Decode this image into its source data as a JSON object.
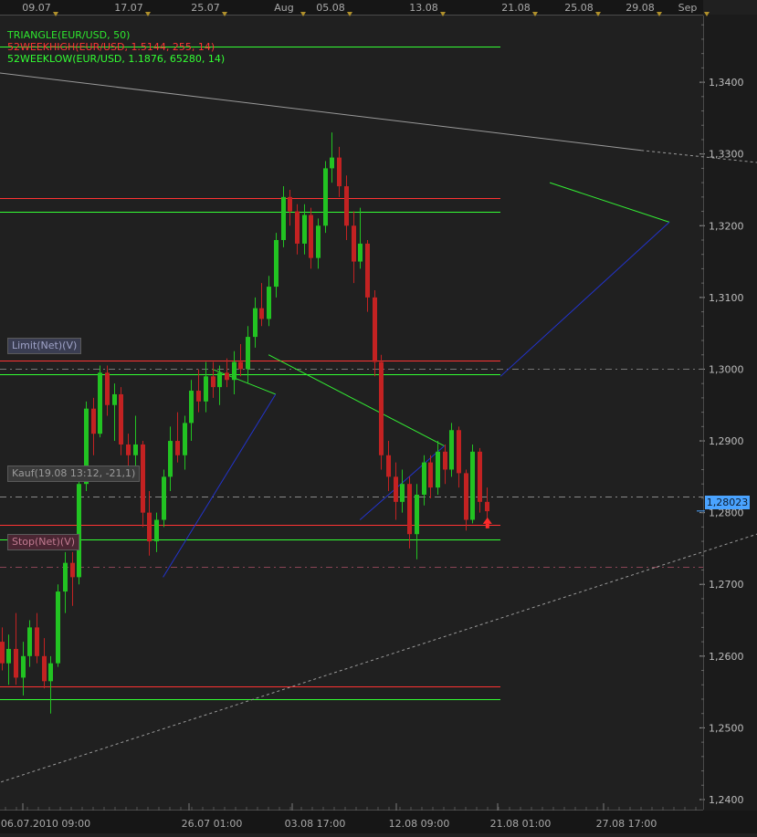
{
  "chart_data": {
    "type": "candlestick",
    "instrument": "EUR/USD",
    "top_dates": [
      "09.07",
      "17.07",
      "25.07",
      "Aug",
      "05.08",
      "13.08",
      "21.08",
      "25.08",
      "29.08",
      "Sep"
    ],
    "bottom_dates": [
      "06.07.2010 09:00",
      "26.07 01:00",
      "03.08 17:00",
      "12.08 09:00",
      "21.08 01:00",
      "27.08 17:00"
    ],
    "y_ticks": [
      "1,2400",
      "1,2500",
      "1,2600",
      "1,2700",
      "1,2800",
      "1,2900",
      "1,3000",
      "1,3100",
      "1,3200",
      "1,3300",
      "1,3400"
    ],
    "ylim": [
      1.2386,
      1.3493
    ],
    "current_price": "1,28023",
    "current_price_value": 1.28023,
    "legend": [
      {
        "text": "TRIANGLE(EUR/USD, 50)",
        "color": "#2ee82e"
      },
      {
        "text": "52WEEKHIGH(EUR/USD, 1.5144, 255, 14)",
        "color": "#ff3333"
      },
      {
        "text": "52WEEKLOW(EUR/USD, 1.1876, 65280, 14)",
        "color": "#33ff33"
      }
    ],
    "tags": {
      "limit": "Limit(Net)(V)",
      "entry": "Kauf(19.08 13:12, -21,1)",
      "stop": "Stop(Net)(V)"
    },
    "levels": {
      "limit": 1.3,
      "entry": 1.2823,
      "stop": 1.2725
    },
    "support_resistance": [
      {
        "value": 1.345,
        "color": "#33ff33"
      },
      {
        "value": 1.3238,
        "color": "#ff3333"
      },
      {
        "value": 1.322,
        "color": "#33ff33"
      },
      {
        "value": 1.3012,
        "color": "#ff3333"
      },
      {
        "value": 1.2993,
        "color": "#33ff33"
      },
      {
        "value": 1.2783,
        "color": "#ff3333"
      },
      {
        "value": 1.2763,
        "color": "#33ff33"
      },
      {
        "value": 1.2558,
        "color": "#ff3333"
      },
      {
        "value": 1.254,
        "color": "#33ff33"
      }
    ],
    "candles": [
      {
        "o": 1.262,
        "h": 1.264,
        "l": 1.258,
        "c": 1.259
      },
      {
        "o": 1.259,
        "h": 1.263,
        "l": 1.256,
        "c": 1.261
      },
      {
        "o": 1.261,
        "h": 1.266,
        "l": 1.256,
        "c": 1.257
      },
      {
        "o": 1.257,
        "h": 1.262,
        "l": 1.2545,
        "c": 1.26
      },
      {
        "o": 1.26,
        "h": 1.265,
        "l": 1.2585,
        "c": 1.264
      },
      {
        "o": 1.264,
        "h": 1.266,
        "l": 1.259,
        "c": 1.26
      },
      {
        "o": 1.26,
        "h": 1.2625,
        "l": 1.2555,
        "c": 1.2565
      },
      {
        "o": 1.2565,
        "h": 1.26,
        "l": 1.252,
        "c": 1.259
      },
      {
        "o": 1.259,
        "h": 1.27,
        "l": 1.2585,
        "c": 1.269
      },
      {
        "o": 1.269,
        "h": 1.2745,
        "l": 1.266,
        "c": 1.273
      },
      {
        "o": 1.273,
        "h": 1.2745,
        "l": 1.267,
        "c": 1.271
      },
      {
        "o": 1.271,
        "h": 1.285,
        "l": 1.27,
        "c": 1.284
      },
      {
        "o": 1.284,
        "h": 1.2955,
        "l": 1.283,
        "c": 1.2945
      },
      {
        "o": 1.2945,
        "h": 1.296,
        "l": 1.288,
        "c": 1.291
      },
      {
        "o": 1.291,
        "h": 1.3005,
        "l": 1.2905,
        "c": 1.2995
      },
      {
        "o": 1.2995,
        "h": 1.3005,
        "l": 1.2935,
        "c": 1.295
      },
      {
        "o": 1.295,
        "h": 1.298,
        "l": 1.29,
        "c": 1.2965
      },
      {
        "o": 1.2965,
        "h": 1.2975,
        "l": 1.288,
        "c": 1.2895
      },
      {
        "o": 1.2895,
        "h": 1.291,
        "l": 1.286,
        "c": 1.288
      },
      {
        "o": 1.288,
        "h": 1.2935,
        "l": 1.285,
        "c": 1.2895
      },
      {
        "o": 1.2895,
        "h": 1.29,
        "l": 1.278,
        "c": 1.28
      },
      {
        "o": 1.28,
        "h": 1.283,
        "l": 1.274,
        "c": 1.276
      },
      {
        "o": 1.276,
        "h": 1.28,
        "l": 1.2745,
        "c": 1.279
      },
      {
        "o": 1.279,
        "h": 1.286,
        "l": 1.278,
        "c": 1.285
      },
      {
        "o": 1.285,
        "h": 1.292,
        "l": 1.283,
        "c": 1.29
      },
      {
        "o": 1.29,
        "h": 1.294,
        "l": 1.287,
        "c": 1.288
      },
      {
        "o": 1.288,
        "h": 1.2935,
        "l": 1.286,
        "c": 1.2925
      },
      {
        "o": 1.2925,
        "h": 1.2985,
        "l": 1.29,
        "c": 1.297
      },
      {
        "o": 1.297,
        "h": 1.3,
        "l": 1.294,
        "c": 1.2955
      },
      {
        "o": 1.2955,
        "h": 1.301,
        "l": 1.294,
        "c": 1.299
      },
      {
        "o": 1.299,
        "h": 1.301,
        "l": 1.296,
        "c": 1.2975
      },
      {
        "o": 1.2975,
        "h": 1.3005,
        "l": 1.295,
        "c": 1.2995
      },
      {
        "o": 1.2995,
        "h": 1.3015,
        "l": 1.2975,
        "c": 1.2985
      },
      {
        "o": 1.2985,
        "h": 1.3025,
        "l": 1.2965,
        "c": 1.301
      },
      {
        "o": 1.301,
        "h": 1.3035,
        "l": 1.299,
        "c": 1.3
      },
      {
        "o": 1.3,
        "h": 1.306,
        "l": 1.298,
        "c": 1.3045
      },
      {
        "o": 1.3045,
        "h": 1.31,
        "l": 1.303,
        "c": 1.3085
      },
      {
        "o": 1.3085,
        "h": 1.312,
        "l": 1.306,
        "c": 1.307
      },
      {
        "o": 1.307,
        "h": 1.313,
        "l": 1.306,
        "c": 1.3115
      },
      {
        "o": 1.3115,
        "h": 1.319,
        "l": 1.31,
        "c": 1.318
      },
      {
        "o": 1.318,
        "h": 1.3255,
        "l": 1.317,
        "c": 1.324
      },
      {
        "o": 1.324,
        "h": 1.325,
        "l": 1.32,
        "c": 1.322
      },
      {
        "o": 1.322,
        "h": 1.323,
        "l": 1.316,
        "c": 1.3175
      },
      {
        "o": 1.3175,
        "h": 1.323,
        "l": 1.316,
        "c": 1.3215
      },
      {
        "o": 1.3215,
        "h": 1.3225,
        "l": 1.314,
        "c": 1.3155
      },
      {
        "o": 1.3155,
        "h": 1.321,
        "l": 1.314,
        "c": 1.32
      },
      {
        "o": 1.32,
        "h": 1.329,
        "l": 1.319,
        "c": 1.328
      },
      {
        "o": 1.328,
        "h": 1.333,
        "l": 1.326,
        "c": 1.3295
      },
      {
        "o": 1.3295,
        "h": 1.331,
        "l": 1.324,
        "c": 1.3255
      },
      {
        "o": 1.3255,
        "h": 1.327,
        "l": 1.318,
        "c": 1.32
      },
      {
        "o": 1.32,
        "h": 1.322,
        "l": 1.312,
        "c": 1.315
      },
      {
        "o": 1.315,
        "h": 1.3225,
        "l": 1.314,
        "c": 1.3175
      },
      {
        "o": 1.3175,
        "h": 1.318,
        "l": 1.308,
        "c": 1.31
      },
      {
        "o": 1.31,
        "h": 1.311,
        "l": 1.299,
        "c": 1.301
      },
      {
        "o": 1.301,
        "h": 1.302,
        "l": 1.286,
        "c": 1.288
      },
      {
        "o": 1.288,
        "h": 1.29,
        "l": 1.283,
        "c": 1.285
      },
      {
        "o": 1.285,
        "h": 1.287,
        "l": 1.279,
        "c": 1.2815
      },
      {
        "o": 1.2815,
        "h": 1.286,
        "l": 1.28,
        "c": 1.284
      },
      {
        "o": 1.284,
        "h": 1.285,
        "l": 1.275,
        "c": 1.277
      },
      {
        "o": 1.277,
        "h": 1.284,
        "l": 1.2735,
        "c": 1.2825
      },
      {
        "o": 1.2825,
        "h": 1.288,
        "l": 1.281,
        "c": 1.287
      },
      {
        "o": 1.287,
        "h": 1.288,
        "l": 1.282,
        "c": 1.2835
      },
      {
        "o": 1.2835,
        "h": 1.29,
        "l": 1.2825,
        "c": 1.2885
      },
      {
        "o": 1.2885,
        "h": 1.2895,
        "l": 1.284,
        "c": 1.286
      },
      {
        "o": 1.286,
        "h": 1.2925,
        "l": 1.285,
        "c": 1.2915
      },
      {
        "o": 1.2915,
        "h": 1.292,
        "l": 1.2835,
        "c": 1.2855
      },
      {
        "o": 1.2855,
        "h": 1.286,
        "l": 1.2775,
        "c": 1.279
      },
      {
        "o": 1.279,
        "h": 1.2895,
        "l": 1.2785,
        "c": 1.2885
      },
      {
        "o": 1.2885,
        "h": 1.289,
        "l": 1.28,
        "c": 1.2815
      },
      {
        "o": 1.2815,
        "h": 1.2835,
        "l": 1.279,
        "c": 1.2802
      }
    ],
    "trend_lines": [
      {
        "x1": -2,
        "y1": 1.3415,
        "x2": 91,
        "y2": 1.3305,
        "color": "#9a9a9a",
        "dash": false
      },
      {
        "x1": 91,
        "y1": 1.3305,
        "x2": 179,
        "y2": 1.3215,
        "color": "#9a9a9a",
        "dash": true
      },
      {
        "x1": -3,
        "y1": 1.2415,
        "x2": 179,
        "y2": 1.3,
        "color": "#9a9a9a",
        "dash": true
      },
      {
        "x1": 122,
        "y1": 1.292,
        "x2": 179,
        "y2": 1.2705,
        "color": "#9a9a9a",
        "dash": true
      },
      {
        "x1": 30,
        "y1": 1.3,
        "x2": 39,
        "y2": 1.2965,
        "color": "#33ee33",
        "dash": false
      },
      {
        "x1": 38,
        "y1": 1.302,
        "x2": 63,
        "y2": 1.2893,
        "color": "#33ee33",
        "dash": false
      },
      {
        "x1": 78,
        "y1": 1.326,
        "x2": 95,
        "y2": 1.3205,
        "color": "#33ee33",
        "dash": false
      },
      {
        "x1": 23,
        "y1": 1.271,
        "x2": 39,
        "y2": 1.2965,
        "color": "#2233cc",
        "dash": false
      },
      {
        "x1": 51,
        "y1": 1.279,
        "x2": 63,
        "y2": 1.2893,
        "color": "#2233cc",
        "dash": false
      },
      {
        "x1": 71,
        "y1": 1.299,
        "x2": 95,
        "y2": 1.3205,
        "color": "#2233cc",
        "dash": false
      }
    ]
  }
}
